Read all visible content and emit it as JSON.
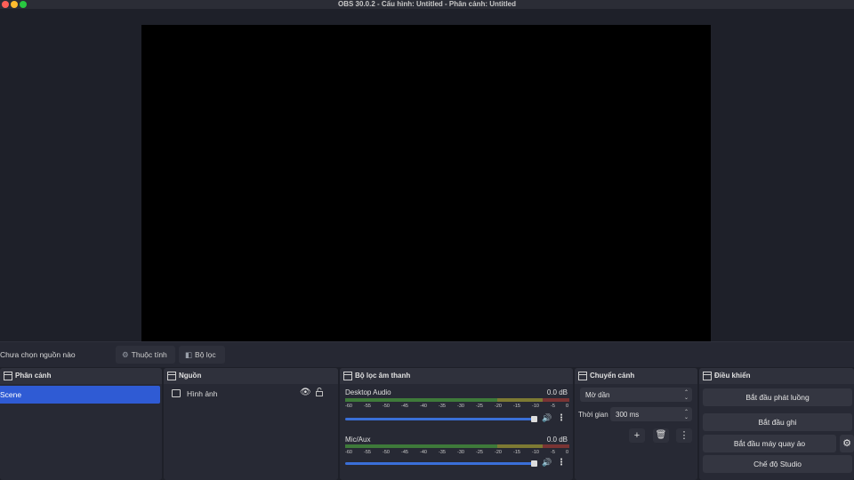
{
  "window": {
    "title": "OBS 30.0.2 - Cấu hình: Untitled - Phân cảnh: Untitled"
  },
  "colors": {
    "accent": "#2f5bd4",
    "background": "#1e2029",
    "preview": "#000000",
    "close": "#ff5f57",
    "minimize": "#febc2e",
    "maximize": "#28c840"
  },
  "contextbar": {
    "no_source": "Chưa chọn nguồn nào",
    "properties_label": "Thuộc tính",
    "filters_label": "Bộ lọc"
  },
  "scenes": {
    "title": "Phân cảnh",
    "items": [
      "Scene"
    ]
  },
  "sources": {
    "title": "Nguồn",
    "items": [
      {
        "label": "Hình ảnh",
        "icon": "image-icon"
      }
    ]
  },
  "audio": {
    "title": "Bộ lọc âm thanh",
    "scale": [
      "-60",
      "-55",
      "-50",
      "-45",
      "-40",
      "-35",
      "-30",
      "-25",
      "-20",
      "-15",
      "-10",
      "-5",
      "0"
    ],
    "channels": [
      {
        "name": "Desktop Audio",
        "db": "0.0 dB",
        "volume": 1.0
      },
      {
        "name": "Mic/Aux",
        "db": "0.0 dB",
        "volume": 1.0
      }
    ]
  },
  "transitions": {
    "title": "Chuyển cảnh",
    "type": "Mờ dần",
    "duration_label": "Thời gian",
    "duration_value": "300 ms"
  },
  "controls": {
    "title": "Điều khiển",
    "start_streaming": "Bắt đầu phát luồng",
    "start_recording": "Bắt đầu ghi",
    "start_virtual_camera": "Bắt đầu máy quay ảo",
    "studio_mode": "Chế độ Studio"
  }
}
